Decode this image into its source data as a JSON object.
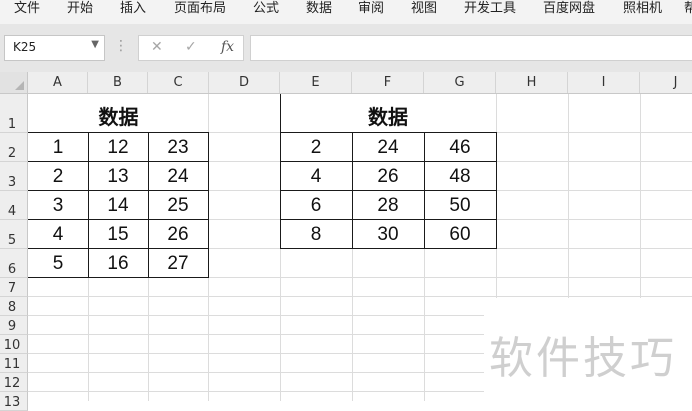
{
  "menu": [
    "文件",
    "开始",
    "插入",
    "页面布局",
    "公式",
    "数据",
    "审阅",
    "视图",
    "开发工具",
    "百度网盘",
    "照相机",
    "帮"
  ],
  "formula_bar": {
    "name_box": "K25",
    "dots_icon": "more-vertical-icon",
    "cancel_icon": "✕",
    "confirm_icon": "✓",
    "fx_label": "fx",
    "formula": ""
  },
  "columns": [
    "A",
    "B",
    "C",
    "D",
    "E",
    "F",
    "G",
    "H",
    "I",
    "J"
  ],
  "rows": [
    "1",
    "2",
    "3",
    "4",
    "5",
    "6",
    "7",
    "8",
    "9",
    "10",
    "11",
    "12",
    "13"
  ],
  "table1": {
    "title": "数据",
    "cells": [
      [
        "1",
        "12",
        "23"
      ],
      [
        "2",
        "13",
        "24"
      ],
      [
        "3",
        "14",
        "25"
      ],
      [
        "4",
        "15",
        "26"
      ],
      [
        "5",
        "16",
        "27"
      ]
    ]
  },
  "table2": {
    "title": "数据",
    "cells": [
      [
        "2",
        "24",
        "46"
      ],
      [
        "4",
        "26",
        "48"
      ],
      [
        "6",
        "28",
        "50"
      ],
      [
        "8",
        "30",
        "60"
      ]
    ]
  },
  "watermark": "软件技巧"
}
